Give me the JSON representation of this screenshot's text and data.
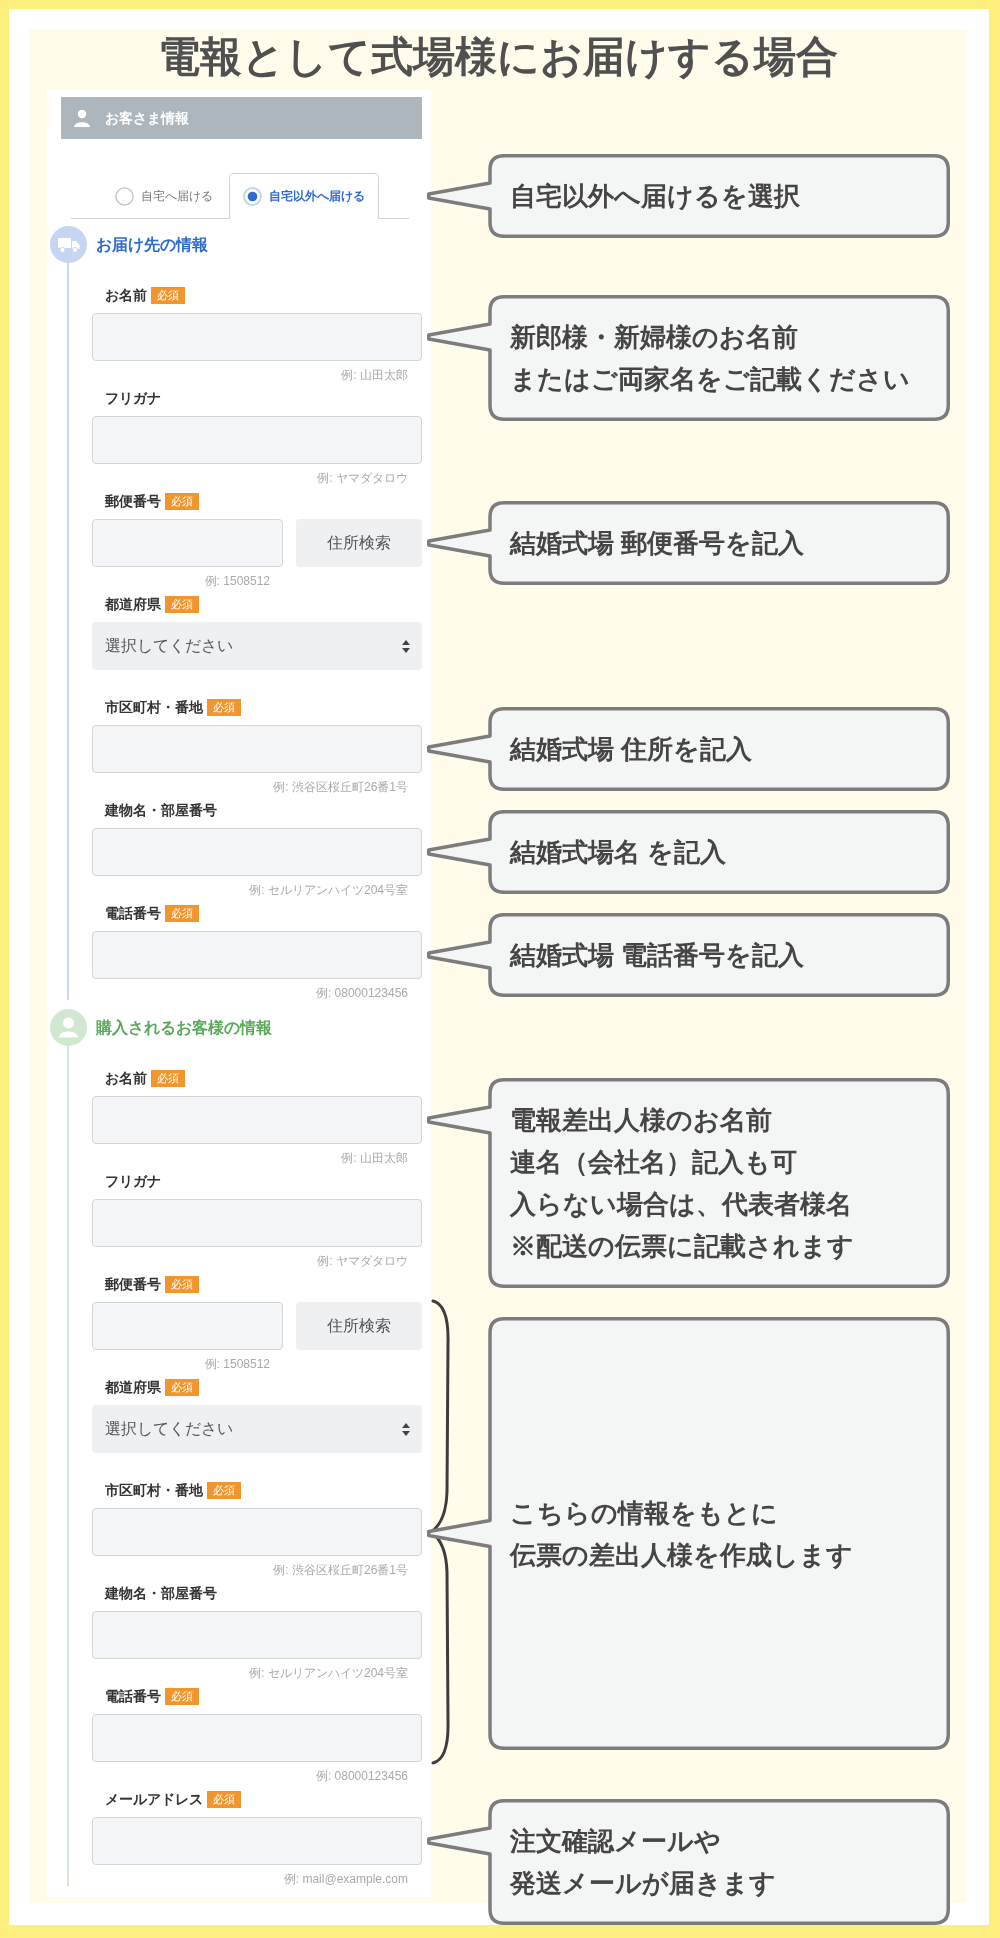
{
  "title": "電報として式場様にお届けする場合",
  "form": {
    "header": {
      "label": "お客さま情報"
    },
    "delivery_tabs": {
      "tabs": [
        {
          "label": "自宅へ届ける",
          "selected": false
        },
        {
          "label": "自宅以外へ届ける",
          "selected": true
        }
      ],
      "callout": {
        "lines": [
          "自宅以外へ届けるを選択"
        ]
      }
    },
    "sections": [
      {
        "kind": "recipient",
        "title": "お届け先の情報",
        "color": "#2f6ad0",
        "fields": [
          {
            "kind": "text",
            "label": "お名前",
            "badge": "必須",
            "hint": "例: 山田太郎",
            "bracketed": false,
            "callout": {
              "lines": [
                "新郎様・新婦様のお名前",
                "またはご両家名をご記載ください"
              ]
            }
          },
          {
            "kind": "text",
            "label": "フリガナ",
            "hint": "例: ヤマダタロウ",
            "bracketed": false
          },
          {
            "kind": "postal",
            "label": "郵便番号",
            "badge": "必須",
            "button": "住所検索",
            "hint": "例: 1508512",
            "bracketed": false,
            "callout": {
              "lines": [
                "結婚式場 郵便番号を記入"
              ]
            }
          },
          {
            "kind": "select",
            "label": "都道府県",
            "badge": "必須",
            "placeholder": "選択してください",
            "bracketed": false
          },
          {
            "kind": "text",
            "label": "市区町村・番地",
            "badge": "必須",
            "hint": "例: 渋谷区桜丘町26番1号",
            "bracketed": false,
            "callout": {
              "lines": [
                "結婚式場 住所を記入"
              ]
            }
          },
          {
            "kind": "text",
            "label": "建物名・部屋番号",
            "hint": "例: セルリアンハイツ204号室",
            "bracketed": false,
            "callout": {
              "lines": [
                "結婚式場名 を記入"
              ]
            }
          },
          {
            "kind": "text",
            "label": "電話番号",
            "badge": "必須",
            "hint": "例: 08000123456",
            "bracketed": false,
            "callout": {
              "lines": [
                "結婚式場 電話番号を記入"
              ]
            }
          }
        ]
      },
      {
        "kind": "purchaser",
        "title": "購入されるお客様の情報",
        "color": "#5aa85a",
        "brace_callout": {
          "lines": [
            "こちらの情報をもとに",
            "伝票の差出人様を作成します"
          ]
        },
        "fields": [
          {
            "kind": "text",
            "label": "お名前",
            "badge": "必須",
            "hint": "例: 山田太郎",
            "bracketed": false,
            "callout": {
              "lines": [
                "電報差出人様のお名前",
                "連名（会社名）記入も可",
                "入らない場合は、代表者様名",
                "※配送の伝票に記載されます"
              ]
            }
          },
          {
            "kind": "text",
            "label": "フリガナ",
            "hint": "例: ヤマダタロウ",
            "bracketed": false
          },
          {
            "kind": "postal",
            "label": "郵便番号",
            "badge": "必須",
            "button": "住所検索",
            "hint": "例: 1508512",
            "bracketed": true
          },
          {
            "kind": "select",
            "label": "都道府県",
            "badge": "必須",
            "placeholder": "選択してください",
            "bracketed": true
          },
          {
            "kind": "text",
            "label": "市区町村・番地",
            "badge": "必須",
            "hint": "例: 渋谷区桜丘町26番1号",
            "bracketed": true
          },
          {
            "kind": "text",
            "label": "建物名・部屋番号",
            "hint": "例: セルリアンハイツ204号室",
            "bracketed": true
          },
          {
            "kind": "text",
            "label": "電話番号",
            "badge": "必須",
            "hint": "例: 08000123456",
            "bracketed": true
          },
          {
            "kind": "text",
            "label": "メールアドレス",
            "badge": "必須",
            "hint": "例: mail@example.com",
            "bracketed": false,
            "callout": {
              "lines": [
                "注文確認メールや",
                "発送メールが届きます"
              ]
            }
          }
        ]
      }
    ]
  }
}
